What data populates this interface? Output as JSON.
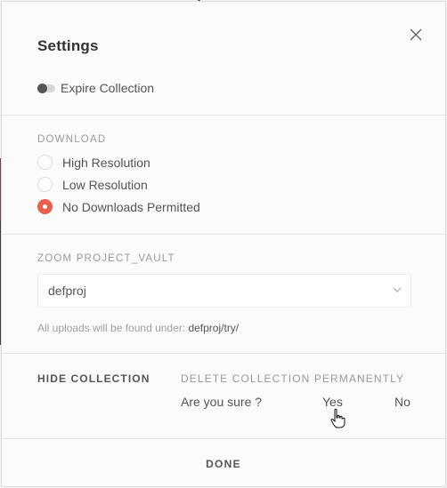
{
  "modal": {
    "title": "Settings",
    "close_icon": "close-icon"
  },
  "expire": {
    "label": "Expire Collection",
    "enabled": false
  },
  "download": {
    "section_label": "DOWNLOAD",
    "options": [
      {
        "label": "High Resolution",
        "selected": false
      },
      {
        "label": "Low Resolution",
        "selected": false
      },
      {
        "label": "No Downloads Permitted",
        "selected": true
      }
    ],
    "accent_color": "#e8604c"
  },
  "vault": {
    "section_label": "ZOOM PROJECT_VAULT",
    "selected": "defproj",
    "hint_prefix": "All uploads will be found under:",
    "hint_path": "defproj/try/"
  },
  "actions": {
    "hide_label": "HIDE COLLECTION",
    "delete_label": "DELETE COLLECTION PERMANENTLY",
    "confirm_text": "Are you sure ?",
    "yes_label": "Yes",
    "no_label": "No"
  },
  "footer": {
    "done_label": "DONE"
  }
}
